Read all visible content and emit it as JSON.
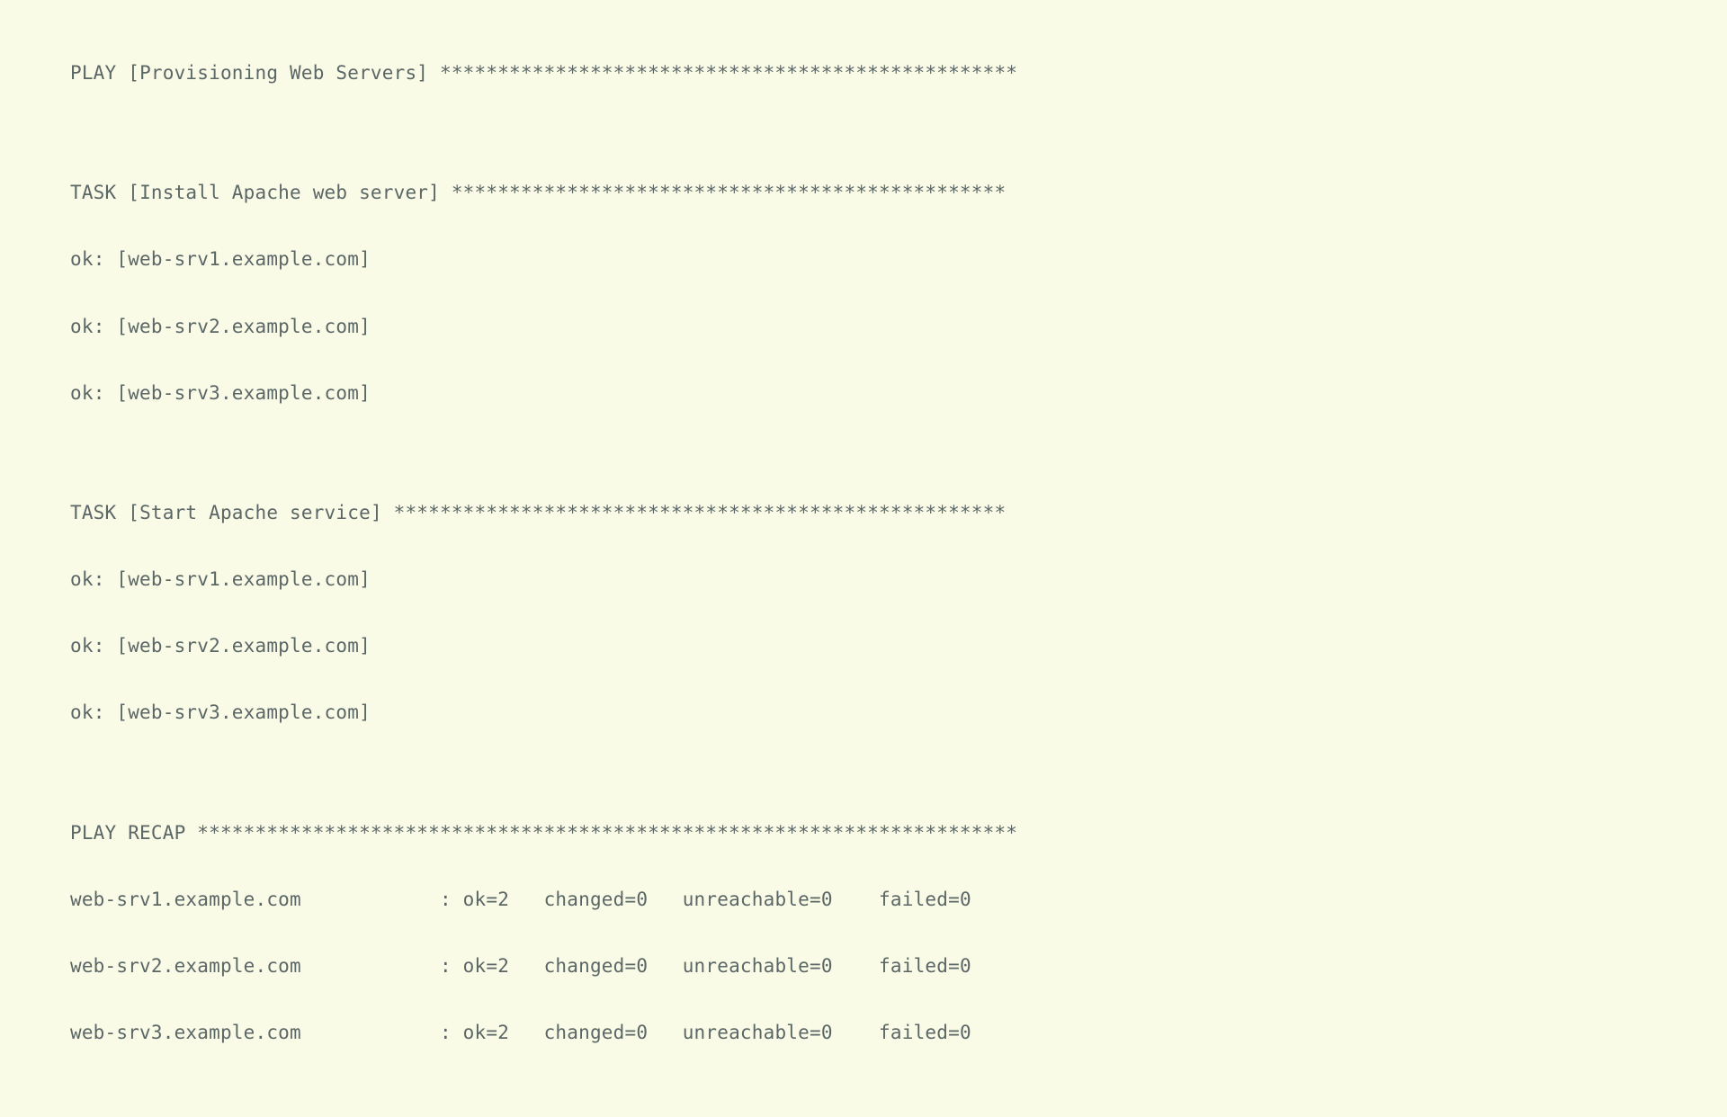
{
  "play": {
    "label": "PLAY",
    "name": "Provisioning Web Servers",
    "stars": "**************************************************"
  },
  "tasks": [
    {
      "label": "TASK",
      "name": "Install Apache web server",
      "stars": "************************************************",
      "results": [
        {
          "status": "ok",
          "host": "web-srv1.example.com"
        },
        {
          "status": "ok",
          "host": "web-srv2.example.com"
        },
        {
          "status": "ok",
          "host": "web-srv3.example.com"
        }
      ]
    },
    {
      "label": "TASK",
      "name": "Start Apache service",
      "stars": "*****************************************************",
      "results": [
        {
          "status": "ok",
          "host": "web-srv1.example.com"
        },
        {
          "status": "ok",
          "host": "web-srv2.example.com"
        },
        {
          "status": "ok",
          "host": "web-srv3.example.com"
        }
      ]
    }
  ],
  "recap": {
    "label": "PLAY RECAP",
    "stars": "***********************************************************************",
    "rows": [
      {
        "host": "web-srv1.example.com",
        "ok": 2,
        "changed": 0,
        "unreachable": 0,
        "failed": 0
      },
      {
        "host": "web-srv2.example.com",
        "ok": 2,
        "changed": 0,
        "unreachable": 0,
        "failed": 0
      },
      {
        "host": "web-srv3.example.com",
        "ok": 2,
        "changed": 0,
        "unreachable": 0,
        "failed": 0
      }
    ]
  }
}
